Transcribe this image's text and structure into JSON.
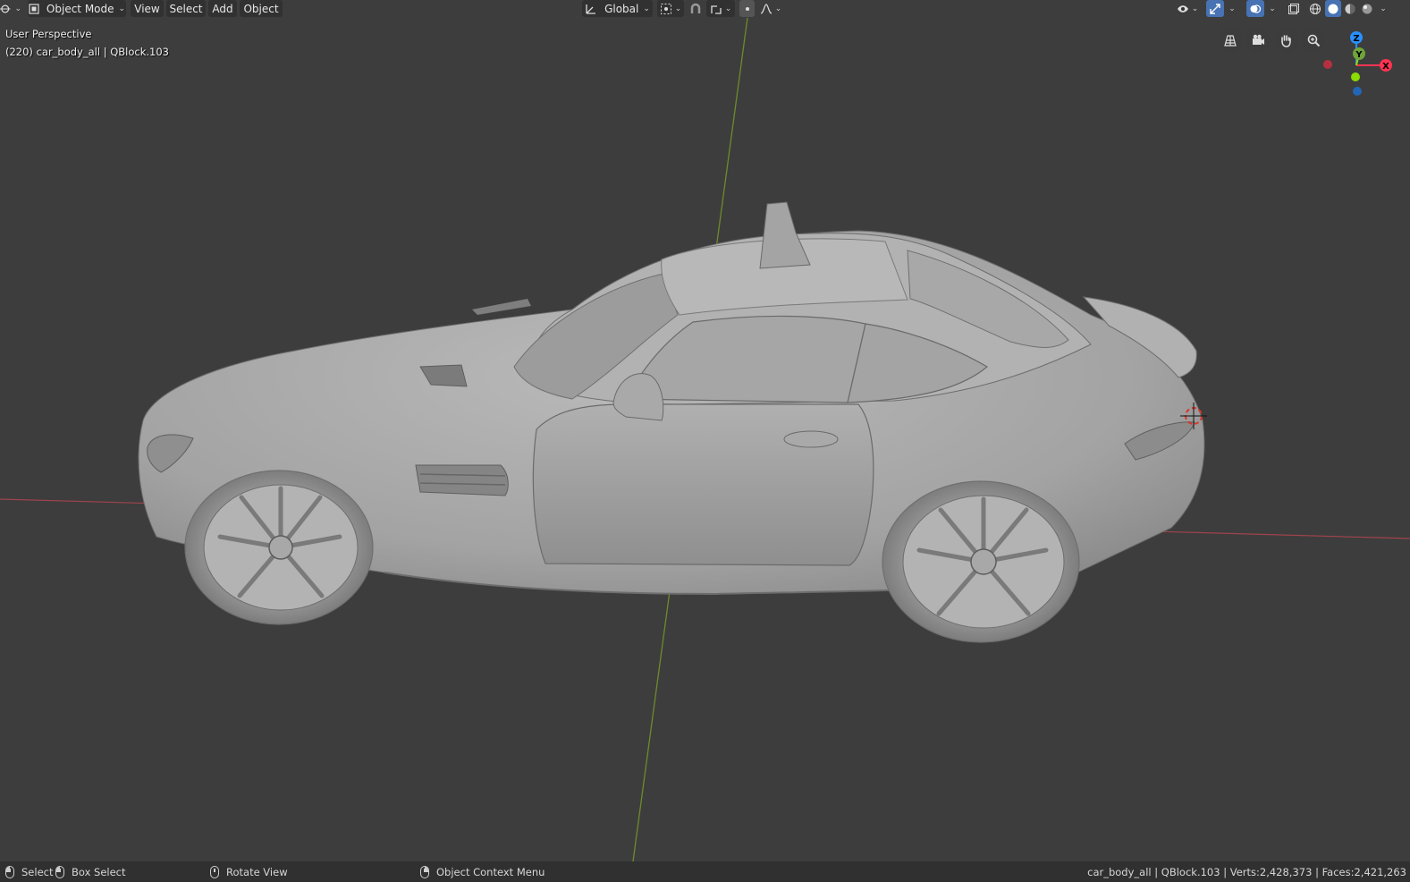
{
  "header": {
    "editor_type_icon": "viewport-editor-icon",
    "mode": {
      "label": "Object Mode",
      "icon": "object-mode-icon"
    },
    "menus": [
      "View",
      "Select",
      "Add",
      "Object"
    ],
    "transform_orientation": {
      "label": "Global",
      "icon": "transform-orientation-icon"
    },
    "pivot_icon": "pivot-point-icon",
    "snap_icon": "snap-magnet-icon",
    "snap_target_icon": "snap-increment-icon",
    "proportional_icon": "proportional-editing-icon",
    "falloff_icon": "falloff-curve-icon",
    "right_icons": [
      "visibility-eye-icon",
      "gizmo-icon",
      "overlays-icon",
      "xray-icon",
      "wireframe-shading-icon",
      "solid-shading-icon",
      "material-shading-icon",
      "rendered-shading-icon"
    ],
    "active_color": "#4772b3"
  },
  "viewport": {
    "perspective_label": "User Perspective",
    "object_label": "(220) car_body_all | QBlock.103",
    "axis_colors": {
      "x": "#ff3352",
      "y": "#8bdc00",
      "z": "#2890ff"
    },
    "gizmo_labels": {
      "x": "X",
      "y": "Y",
      "z": "Z"
    },
    "nav_icons": [
      "toggle-ortho-grid-icon",
      "camera-view-icon",
      "pan-hand-icon",
      "zoom-magnifier-icon"
    ],
    "background_color": "#3d3d3d",
    "model_color": "#a9a9a9"
  },
  "statusbar": {
    "select": "Select",
    "box_select": "Box Select",
    "rotate_view": "Rotate View",
    "context_menu": "Object Context Menu",
    "stats": "car_body_all | QBlock.103 | Verts:2,428,373 | Faces:2,421,263"
  }
}
